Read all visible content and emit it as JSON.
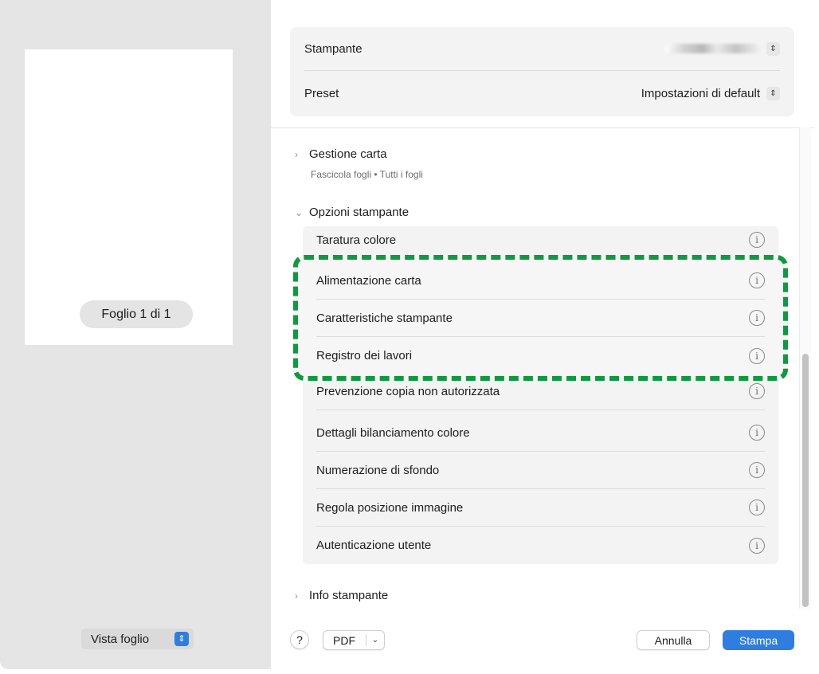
{
  "preview": {
    "sheet_label": "Foglio 1 di 1",
    "view_select": "Vista foglio"
  },
  "printer": {
    "label": "Stampante",
    "value": "",
    "preset_label": "Preset",
    "preset_value": "Impostazioni di default"
  },
  "sections": {
    "paper": {
      "title": "Gestione carta",
      "subtitle": "Fascicola fogli • Tutti i fogli",
      "expanded": false
    },
    "options": {
      "title": "Opzioni stampante",
      "expanded": true,
      "items": [
        "Taratura colore",
        "Alimentazione carta",
        "Caratteristiche stampante",
        "Registro dei lavori",
        "Prevenzione copia non autorizzata",
        "Dettagli bilanciamento colore",
        "Numerazione di sfondo",
        "Regola posizione immagine",
        "Autenticazione utente"
      ]
    },
    "info": {
      "title": "Info stampante",
      "expanded": false
    }
  },
  "buttons": {
    "help": "?",
    "pdf": "PDF",
    "cancel": "Annulla",
    "print": "Stampa"
  },
  "icons": {
    "info": "info-icon",
    "chevron_right": "chevron-right-icon",
    "chevron_down": "chevron-down-icon",
    "updown": "updown-chevron-icon"
  },
  "colors": {
    "accent": "#2f7de1",
    "highlight": "#0e9a3e"
  }
}
